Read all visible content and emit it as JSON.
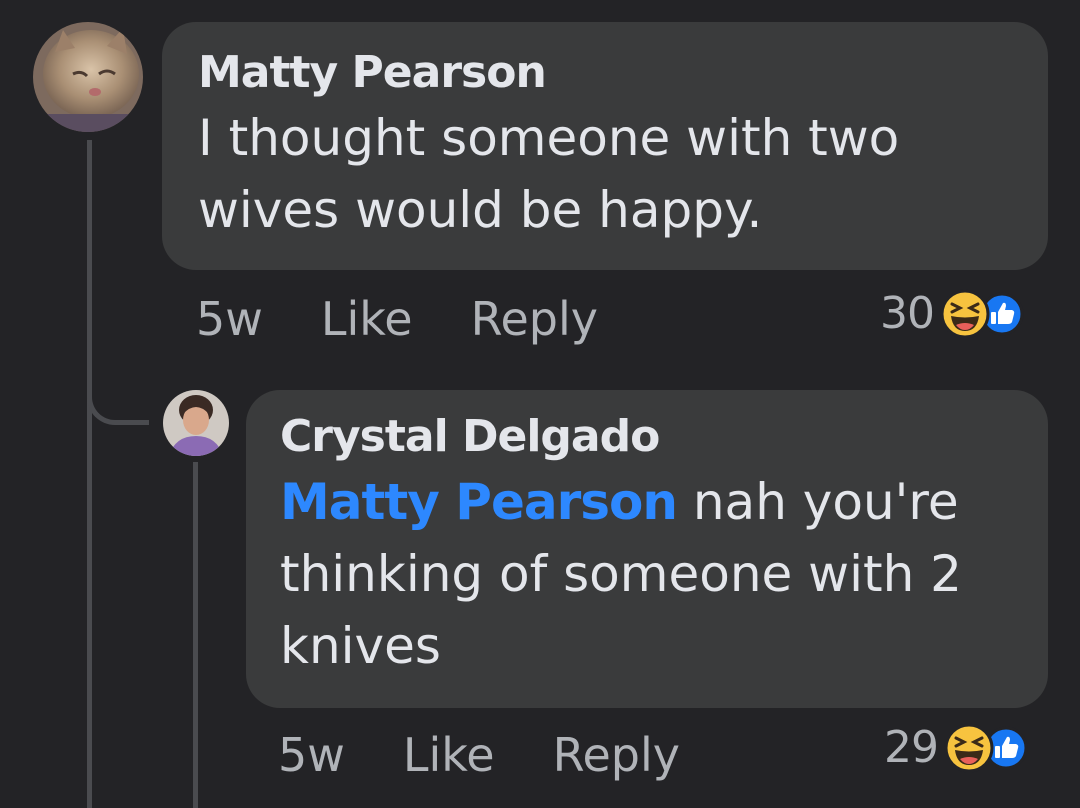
{
  "comment": {
    "author": "Matty Pearson",
    "text_line_1": "I thought someone with two",
    "text_line_2": "wives would be happy.",
    "time": "5w",
    "like_label": "Like",
    "reply_label": "Reply",
    "reaction_count": "30",
    "reaction_icons": [
      "haha-icon",
      "like-icon"
    ]
  },
  "reply": {
    "author": "Crystal Delgado",
    "mention": "Matty Pearson",
    "text_line_1": " nah you're",
    "text_line_2": "thinking of someone with 2",
    "text_line_3": "knives",
    "time": "5w",
    "like_label": "Like",
    "reply_label": "Reply",
    "reaction_count": "29",
    "reaction_icons": [
      "haha-icon",
      "like-icon"
    ]
  },
  "colors": {
    "background": "#232326",
    "bubble": "#3a3b3c",
    "mention": "#2d88ff",
    "secondary_text": "#b0b3b8"
  }
}
